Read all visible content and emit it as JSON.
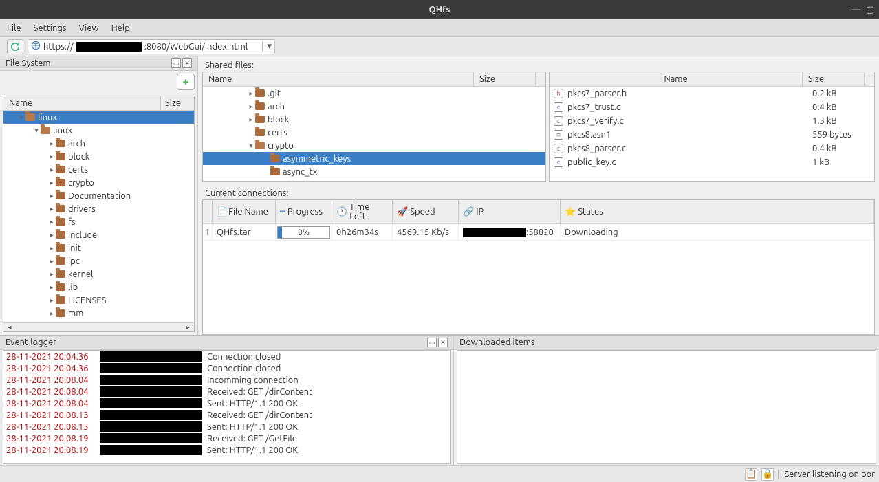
{
  "window": {
    "title": "QHfs"
  },
  "menu": {
    "file": "File",
    "settings": "Settings",
    "view": "View",
    "help": "Help"
  },
  "url": {
    "prefix": "https://",
    "suffix": ":8080/WebGui/index.html"
  },
  "fs_panel": {
    "title": "File System",
    "headers": {
      "name": "Name",
      "size": "Size"
    },
    "tree": [
      {
        "label": "linux",
        "depth": 1,
        "expanded": true,
        "selected": true
      },
      {
        "label": "linux",
        "depth": 2,
        "expanded": true
      },
      {
        "label": "arch",
        "depth": 3,
        "expandable": true
      },
      {
        "label": "block",
        "depth": 3,
        "expandable": true
      },
      {
        "label": "certs",
        "depth": 3,
        "expandable": true
      },
      {
        "label": "crypto",
        "depth": 3,
        "expandable": true
      },
      {
        "label": "Documentation",
        "depth": 3,
        "expandable": true
      },
      {
        "label": "drivers",
        "depth": 3,
        "expandable": true
      },
      {
        "label": "fs",
        "depth": 3,
        "expandable": true
      },
      {
        "label": "include",
        "depth": 3,
        "expandable": true
      },
      {
        "label": "init",
        "depth": 3,
        "expandable": true
      },
      {
        "label": "ipc",
        "depth": 3,
        "expandable": true
      },
      {
        "label": "kernel",
        "depth": 3,
        "expandable": true
      },
      {
        "label": "lib",
        "depth": 3,
        "expandable": true
      },
      {
        "label": "LICENSES",
        "depth": 3,
        "expandable": true
      },
      {
        "label": "mm",
        "depth": 3,
        "expandable": true
      }
    ]
  },
  "shared": {
    "label": "Shared files:",
    "headers": {
      "name": "Name",
      "size": "Size"
    },
    "left_tree": [
      {
        "label": ".git",
        "depth": 3,
        "expandable": true
      },
      {
        "label": "arch",
        "depth": 3,
        "expandable": true
      },
      {
        "label": "block",
        "depth": 3,
        "expandable": true
      },
      {
        "label": "certs",
        "depth": 3,
        "expandable": false
      },
      {
        "label": "crypto",
        "depth": 3,
        "expanded": true
      },
      {
        "label": "asymmetric_keys",
        "depth": 4,
        "selected": true
      },
      {
        "label": "async_tx",
        "depth": 4
      }
    ],
    "files": [
      {
        "icon": "h",
        "name": "pkcs7_parser.h",
        "size": "0.2 kB"
      },
      {
        "icon": "c",
        "name": "pkcs7_trust.c",
        "size": "0.4 kB"
      },
      {
        "icon": "c",
        "name": "pkcs7_verify.c",
        "size": "1.3 kB"
      },
      {
        "icon": "g",
        "name": "pkcs8.asn1",
        "size": "559 bytes"
      },
      {
        "icon": "c",
        "name": "pkcs8_parser.c",
        "size": "0.4 kB"
      },
      {
        "icon": "c",
        "name": "public_key.c",
        "size": "1 kB"
      }
    ]
  },
  "connections": {
    "label": "Current connections:",
    "headers": {
      "filename": "File Name",
      "progress": "Progress",
      "timeleft": "Time Left",
      "speed": "Speed",
      "ip": "IP",
      "status": "Status"
    },
    "rows": [
      {
        "num": "1",
        "filename": "QHfs.tar",
        "progress_pct": "8%",
        "progress_val": 8,
        "timeleft": "0h26m34s",
        "speed": "4569.15 Kb/s",
        "ip_port": ":58820",
        "status": "Downloading"
      }
    ]
  },
  "log": {
    "label": "Event logger",
    "entries": [
      {
        "ts": "28-11-2021 20.04.36",
        "msg": "Connection closed"
      },
      {
        "ts": "28-11-2021 20.04.36",
        "msg": "Connection closed"
      },
      {
        "ts": "28-11-2021 20.08.04",
        "msg": "Incomming connection"
      },
      {
        "ts": "28-11-2021 20.08.04",
        "msg": "Received: GET /dirContent"
      },
      {
        "ts": "28-11-2021 20.08.04",
        "msg": "Sent: HTTP/1.1 200 OK"
      },
      {
        "ts": "28-11-2021 20.08.13",
        "msg": "Received: GET /dirContent"
      },
      {
        "ts": "28-11-2021 20.08.13",
        "msg": "Sent: HTTP/1.1 200 OK"
      },
      {
        "ts": "28-11-2021 20.08.19",
        "msg": "Received: GET /GetFile"
      },
      {
        "ts": "28-11-2021 20.08.19",
        "msg": "Sent: HTTP/1.1 200 OK"
      }
    ]
  },
  "downloads": {
    "label": "Downloaded items"
  },
  "status": {
    "text": "Server listening on por"
  }
}
